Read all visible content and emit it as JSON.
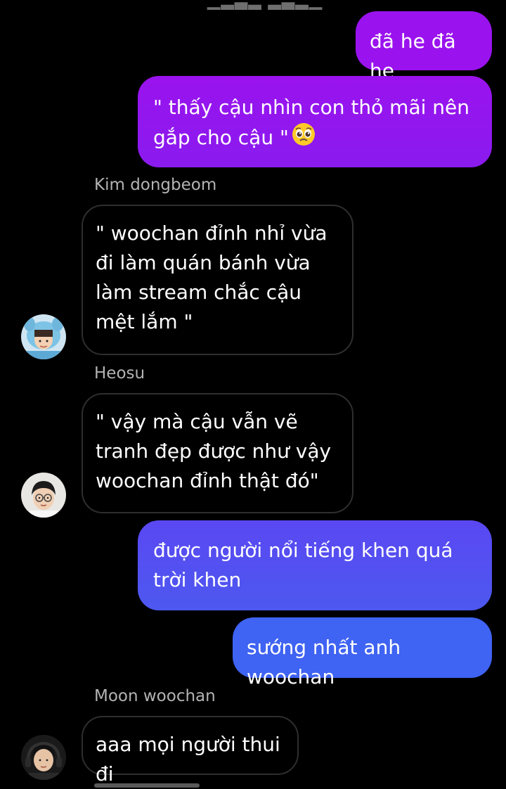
{
  "messages": [
    {
      "text": "đã he đã he"
    },
    {
      "text": "\" thấy cậu nhìn con thỏ mãi nên gắp cho cậu \"",
      "emoji": "pleading-face"
    },
    {
      "sender": "Kim dongbeom",
      "text": "\" woochan đỉnh nhỉ vừa đi làm quán bánh vừa làm stream chắc cậu mệt lắm \""
    },
    {
      "sender": "Heosu",
      "text": "\" vậy mà cậu vẫn vẽ tranh đẹp được như vậy woochan đỉnh thật đó\""
    },
    {
      "text": "được người nổi tiếng khen quá trời khen"
    },
    {
      "text": "sướng nhất anh woochan"
    },
    {
      "sender": "Moon woochan",
      "text": "aaa mọi người thui đi"
    }
  ]
}
